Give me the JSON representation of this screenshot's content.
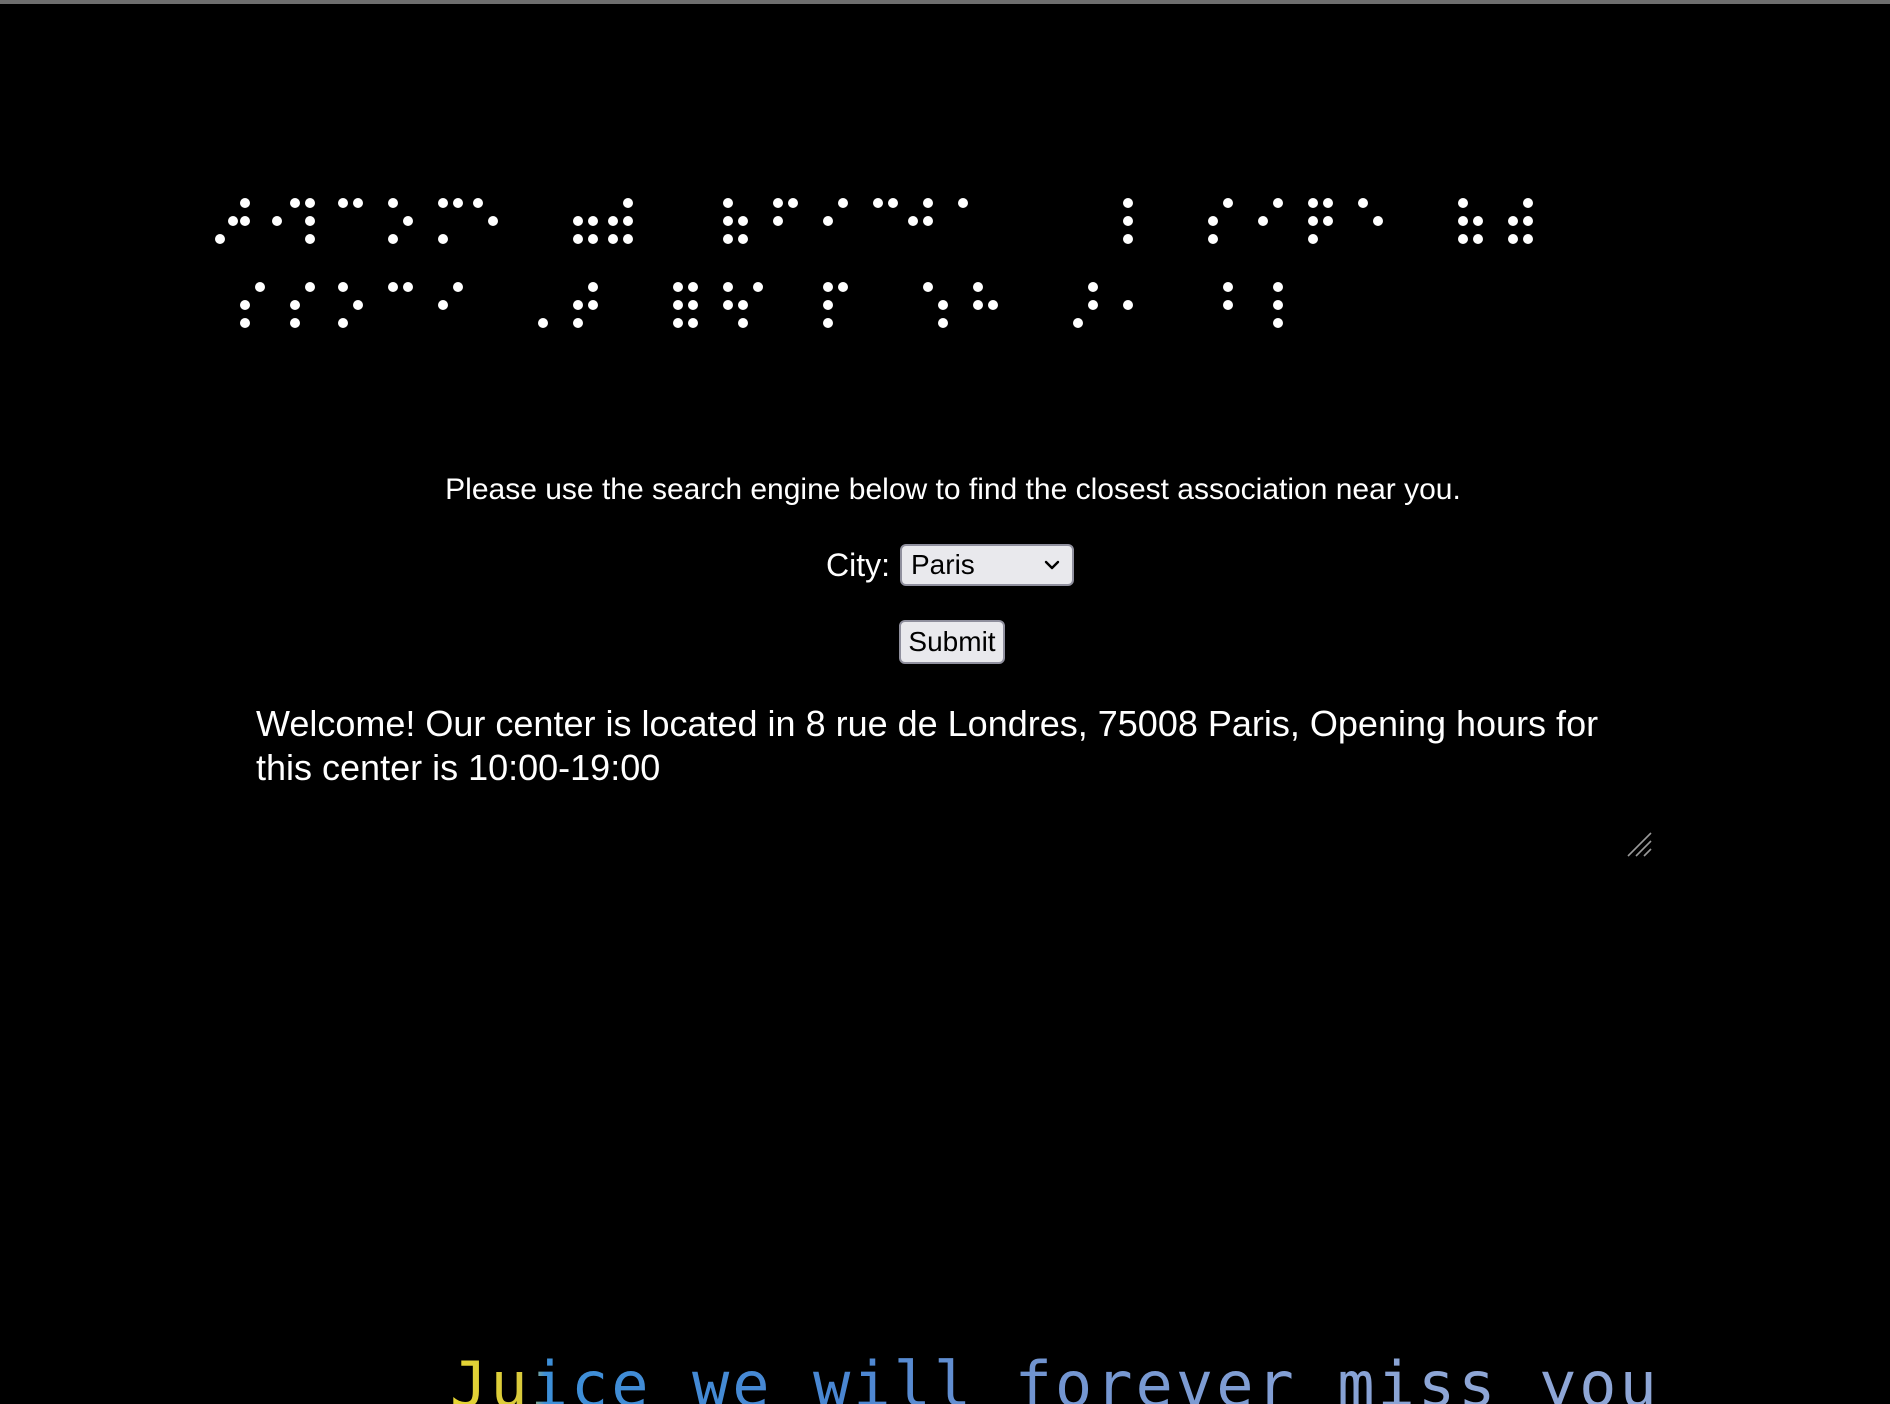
{
  "banner": {
    "braille_text": "⠠⠏⠇⠑⠁⠎⠑ ⠿⠿ ⠋⠊⠝⠙ ⠁⠝ ⠁⠎⠎⠕⠉⠊⠁⠞⠊⠕⠝"
  },
  "search": {
    "instructions": "Please use the search engine below to find the closest association near you.",
    "city_label": "City:",
    "city_selected": "Paris",
    "submit_label": "Submit"
  },
  "result": {
    "message": "Welcome! Our center is located in 8 rue de Londres, 75008 Paris, Opening hours for this center is 10:00-19:00"
  },
  "footer": {
    "tribute": "Juice we will forever miss you"
  },
  "colors": {
    "background": "#000000",
    "text": "#ffffff",
    "control_bg": "#e9e9ed",
    "control_border": "#8f8f9d",
    "tribute_yellow": "#e7d633",
    "tribute_blue": "#3d8fd8"
  }
}
